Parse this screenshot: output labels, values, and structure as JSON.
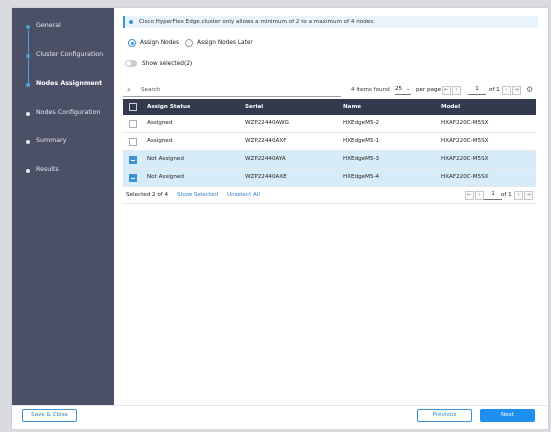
{
  "sidebar": {
    "steps": [
      {
        "label": "General",
        "state": "done"
      },
      {
        "label": "Cluster Configuration",
        "state": "done"
      },
      {
        "label": "Nodes Assignment",
        "state": "current"
      },
      {
        "label": "Nodes Configuration",
        "state": "pending"
      },
      {
        "label": "Summary",
        "state": "pending"
      },
      {
        "label": "Results",
        "state": "pending"
      }
    ]
  },
  "banner": {
    "text": "Cisco HyperFlex Edge cluster only allows a minimum of 2 to a maximum of 4 nodes."
  },
  "radios": {
    "assign_now": {
      "label": "Assign Nodes",
      "selected": true
    },
    "assign_later": {
      "label": "Assign Nodes Later",
      "selected": false
    }
  },
  "toggle": {
    "label": "Show selected(2)",
    "on": false
  },
  "table_controls": {
    "search_placeholder": "Search",
    "items_found": "4 items found",
    "per_page_value": "25",
    "per_page_label": "per page",
    "page_value": "1",
    "page_of": "of 1"
  },
  "table": {
    "columns": [
      "Assign Status",
      "Serial",
      "Name",
      "Model"
    ],
    "rows": [
      {
        "status": "Assigned",
        "serial": "WZP22440AWG",
        "name": "HXEdgeM5-2",
        "model": "HXAF220C-M5SX",
        "selected": false
      },
      {
        "status": "Assigned",
        "serial": "WZP22440AXF",
        "name": "HXEdgeM5-1",
        "model": "HXAF220C-M5SX",
        "selected": false
      },
      {
        "status": "Not Assigned",
        "serial": "WZP22440AYA",
        "name": "HXEdgeM5-3",
        "model": "HXAF220C-M5SX",
        "selected": true
      },
      {
        "status": "Not Assigned",
        "serial": "WZP22440AXE",
        "name": "HXEdgeM5-4",
        "model": "HXAF220C-M5SX",
        "selected": true
      }
    ],
    "footer": {
      "selected_prefix": "Selected",
      "selected_count": "2 of 4",
      "show_selected": "Show Selected",
      "unselect_all": "Unselect All",
      "page_value": "1",
      "page_of": "of 1"
    }
  },
  "footer_buttons": {
    "save_close": "Save & Close",
    "previous": "Previous",
    "next": "Next"
  },
  "colors": {
    "sidebar_bg": "#4b5066",
    "accent": "#3e93d6",
    "primary_button": "#1e8ff0",
    "table_header_bg": "#343a4e",
    "selected_row_bg": "#d7ecf9"
  }
}
